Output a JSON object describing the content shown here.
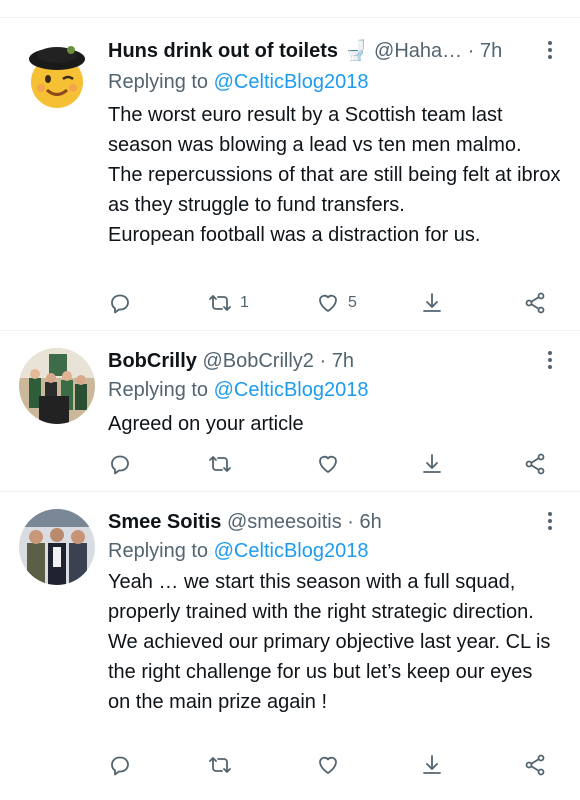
{
  "tweets": [
    {
      "name": "Huns drink out of toilets",
      "emoji": "🚽",
      "handle": "@Haha…",
      "time": "7h",
      "replying_label": "Replying to",
      "replying_to": "@CelticBlog2018",
      "text_lines": [
        "The worst euro result by a Scottish team last season was blowing a lead vs ten men malmo.",
        "The repercussions of that are still being felt at ibrox as they struggle to fund transfers.",
        "European football was a distraction for us."
      ],
      "retweets": "1",
      "likes": "5"
    },
    {
      "name": "BobCrilly",
      "handle": "@BobCrilly2",
      "time": "7h",
      "replying_label": "Replying to",
      "replying_to": "@CelticBlog2018",
      "text_lines": [
        "Agreed on your article"
      ],
      "retweets": "",
      "likes": ""
    },
    {
      "name": "Smee Soitis",
      "handle": "@smeesoitis",
      "time": "6h",
      "replying_label": "Replying to",
      "replying_to": "@CelticBlog2018",
      "text_lines": [
        "Yeah … we start this season with a full squad, properly trained with the right strategic direction. We achieved our primary objective last year. CL is the right challenge for us but let’s keep our eyes on the main prize again !"
      ],
      "retweets": "",
      "likes": ""
    }
  ],
  "colors": {
    "text": "#0f1419",
    "secondary": "#536471",
    "link": "#1d9bf0",
    "divider": "#eff3f4"
  },
  "icons": [
    "reply-icon",
    "retweet-icon",
    "like-icon",
    "share-icon",
    "more-icon"
  ]
}
